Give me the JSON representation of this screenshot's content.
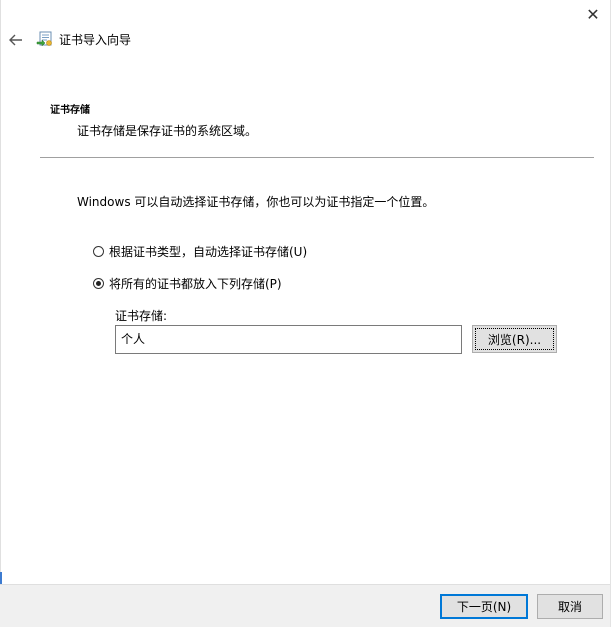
{
  "window": {
    "close_glyph": "✕",
    "back_glyph": "←",
    "title": "证书导入向导"
  },
  "section": {
    "heading": "证书存储",
    "description": "证书存储是保存证书的系统区域。"
  },
  "intro": "Windows 可以自动选择证书存储，你也可以为证书指定一个位置。",
  "options": {
    "auto": {
      "label": "根据证书类型，自动选择证书存储(U)",
      "checked": false
    },
    "manual": {
      "label": "将所有的证书都放入下列存储(P)",
      "checked": true
    }
  },
  "store": {
    "label": "证书存储:",
    "value": "个人",
    "browse_label": "浏览(R)..."
  },
  "footer": {
    "next_label": "下一页(N)",
    "cancel_label": "取消"
  },
  "colors": {
    "accent": "#0078d7",
    "footer_bg": "#f0f0f0"
  },
  "icons": {
    "back": "back-arrow-icon",
    "close": "close-icon",
    "wizard": "certificate-wizard-icon"
  }
}
